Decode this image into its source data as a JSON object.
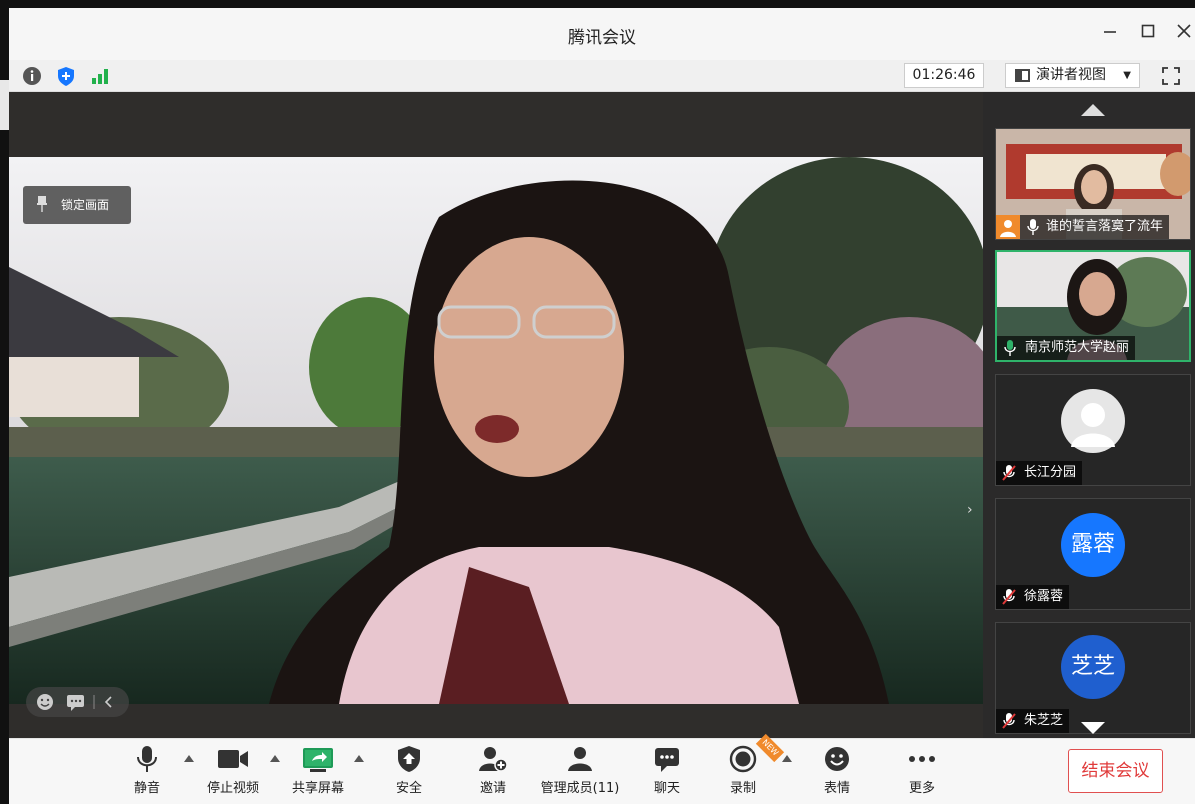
{
  "window": {
    "title": "腾讯会议"
  },
  "toolbar": {
    "timer": "01:26:46",
    "view_mode": "演讲者视图"
  },
  "stage": {
    "lock_label": "锁定画面"
  },
  "participants": [
    {
      "name": "谁的誓言落寞了流年",
      "avatar_text": "",
      "state": "video"
    },
    {
      "name": "南京师范大学赵丽",
      "avatar_text": "",
      "state": "video-active"
    },
    {
      "name": "长江分园",
      "avatar_text": "",
      "state": "muted"
    },
    {
      "name": "徐露蓉",
      "avatar_text": "露蓉",
      "state": "muted"
    },
    {
      "name": "朱芝芝",
      "avatar_text": "芝芝",
      "state": "muted"
    }
  ],
  "bottom": {
    "mute": "静音",
    "stop_video": "停止视频",
    "share_screen": "共享屏幕",
    "security": "安全",
    "invite": "邀请",
    "manage_members": "管理成员(11)",
    "chat": "聊天",
    "record": "录制",
    "record_badge": "NEW",
    "reactions": "表情",
    "more": "更多",
    "end_meeting": "结束会议"
  },
  "colors": {
    "accent_blue": "#1677ff",
    "active_green": "#2fb36a",
    "end_red": "#e03a3a"
  }
}
